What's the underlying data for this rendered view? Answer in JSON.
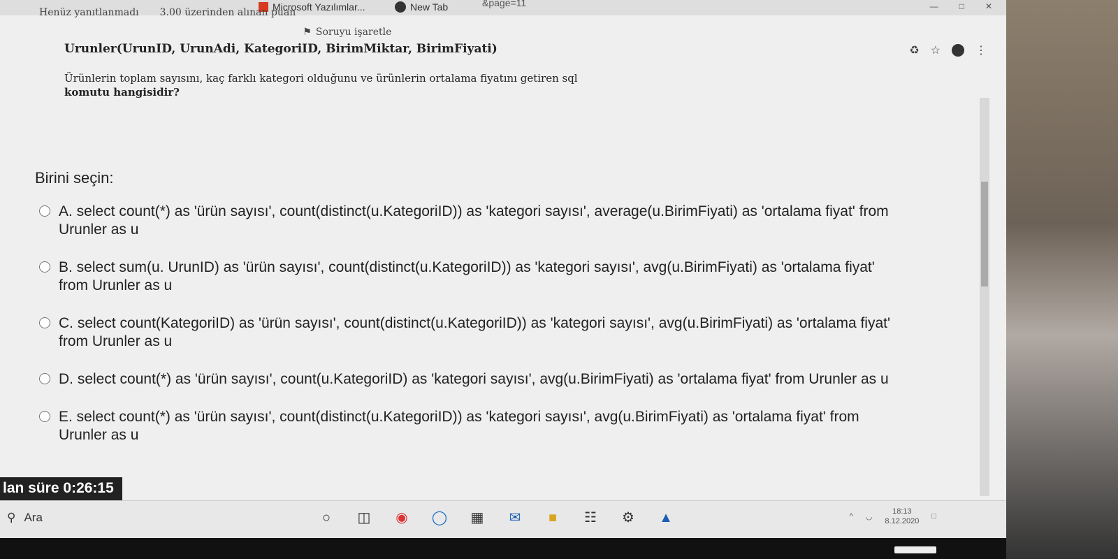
{
  "browser": {
    "tab_ms": "Microsoft Yazılımlar...",
    "tab_new": "New Tab",
    "url_fragment": "&page=11"
  },
  "question": {
    "status": "Henüz yanıtlanmadı",
    "points": "3.00 üzerinden alınan puan",
    "flag_label": "Soruyu işaretle",
    "schema": "Urunler(UrunID, UrunAdi, KategoriID, BirimMiktar, BirimFiyati)",
    "prompt_line1": "Ürünlerin toplam sayısını, kaç farklı kategori olduğunu ve ürünlerin ortalama fiyatını getiren sql",
    "prompt_line2": "komutu hangisidir?",
    "choose_label": "Birini seçin:",
    "options": [
      {
        "text": "A. select count(*) as 'ürün sayısı', count(distinct(u.KategoriID)) as 'kategori sayısı', average(u.BirimFiyati) as 'ortalama fiyat' from Urunler as u"
      },
      {
        "text": "B. select sum(u. UrunID) as 'ürün sayısı', count(distinct(u.KategoriID)) as 'kategori sayısı', avg(u.BirimFiyati) as 'ortalama fiyat' from Urunler as u"
      },
      {
        "text": "C. select count(KategoriID) as 'ürün sayısı', count(distinct(u.KategoriID)) as 'kategori sayısı', avg(u.BirimFiyati) as 'ortalama fiyat' from Urunler as u"
      },
      {
        "text": "D. select count(*) as 'ürün sayısı', count(u.KategoriID) as 'kategori sayısı', avg(u.BirimFiyati) as 'ortalama fiyat' from Urunler as u"
      },
      {
        "text": "E. select count(*) as 'ürün sayısı', count(distinct(u.KategoriID)) as 'kategori sayısı', avg(u.BirimFiyati) as 'ortalama fiyat' from Urunler as u"
      }
    ]
  },
  "timer": {
    "label": "lan süre",
    "value": "0:26:15"
  },
  "taskbar": {
    "search_label": "Ara",
    "time": "18:13",
    "date": "8.12.2020"
  }
}
